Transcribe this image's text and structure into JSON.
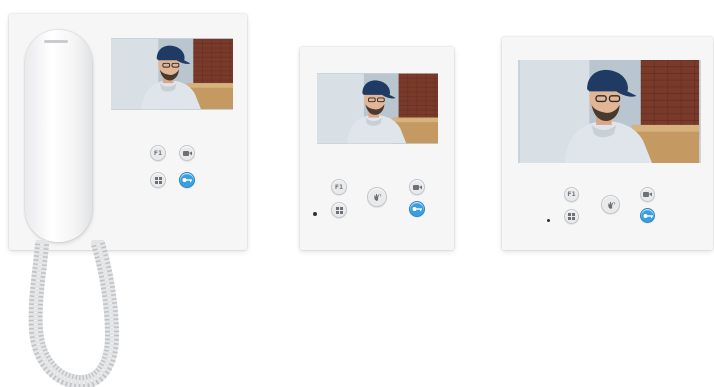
{
  "products": [
    {
      "model": "handset-video-monitor",
      "buttons": [
        {
          "name": "f1",
          "label": "F1",
          "icon": "f1-text"
        },
        {
          "name": "camera",
          "label": "",
          "icon": "camera-icon"
        },
        {
          "name": "menu",
          "label": "",
          "icon": "grid-icon"
        },
        {
          "name": "key",
          "label": "",
          "icon": "key-icon",
          "color": "#3a9fe0"
        }
      ]
    },
    {
      "model": "compact-hands-free-monitor",
      "buttons": [
        {
          "name": "f1",
          "label": "F1",
          "icon": "f1-text"
        },
        {
          "name": "camera",
          "label": "",
          "icon": "camera-icon"
        },
        {
          "name": "talk",
          "label": "",
          "icon": "hand-wave-icon"
        },
        {
          "name": "menu",
          "label": "",
          "icon": "grid-icon"
        },
        {
          "name": "key",
          "label": "",
          "icon": "key-icon",
          "color": "#3a9fe0"
        }
      ]
    },
    {
      "model": "wide-hands-free-monitor",
      "buttons": [
        {
          "name": "f1",
          "label": "F1",
          "icon": "f1-text"
        },
        {
          "name": "camera",
          "label": "",
          "icon": "camera-icon"
        },
        {
          "name": "talk",
          "label": "",
          "icon": "hand-wave-icon"
        },
        {
          "name": "menu",
          "label": "",
          "icon": "grid-icon"
        },
        {
          "name": "key",
          "label": "",
          "icon": "key-icon",
          "color": "#3a9fe0"
        }
      ]
    }
  ],
  "colors": {
    "monitor_body": "#f6f6f7",
    "key_button": "#3a9fe0",
    "cap": "#1f3a63",
    "brick": "#7a3a2a",
    "shirt": "#dfe5ea"
  }
}
